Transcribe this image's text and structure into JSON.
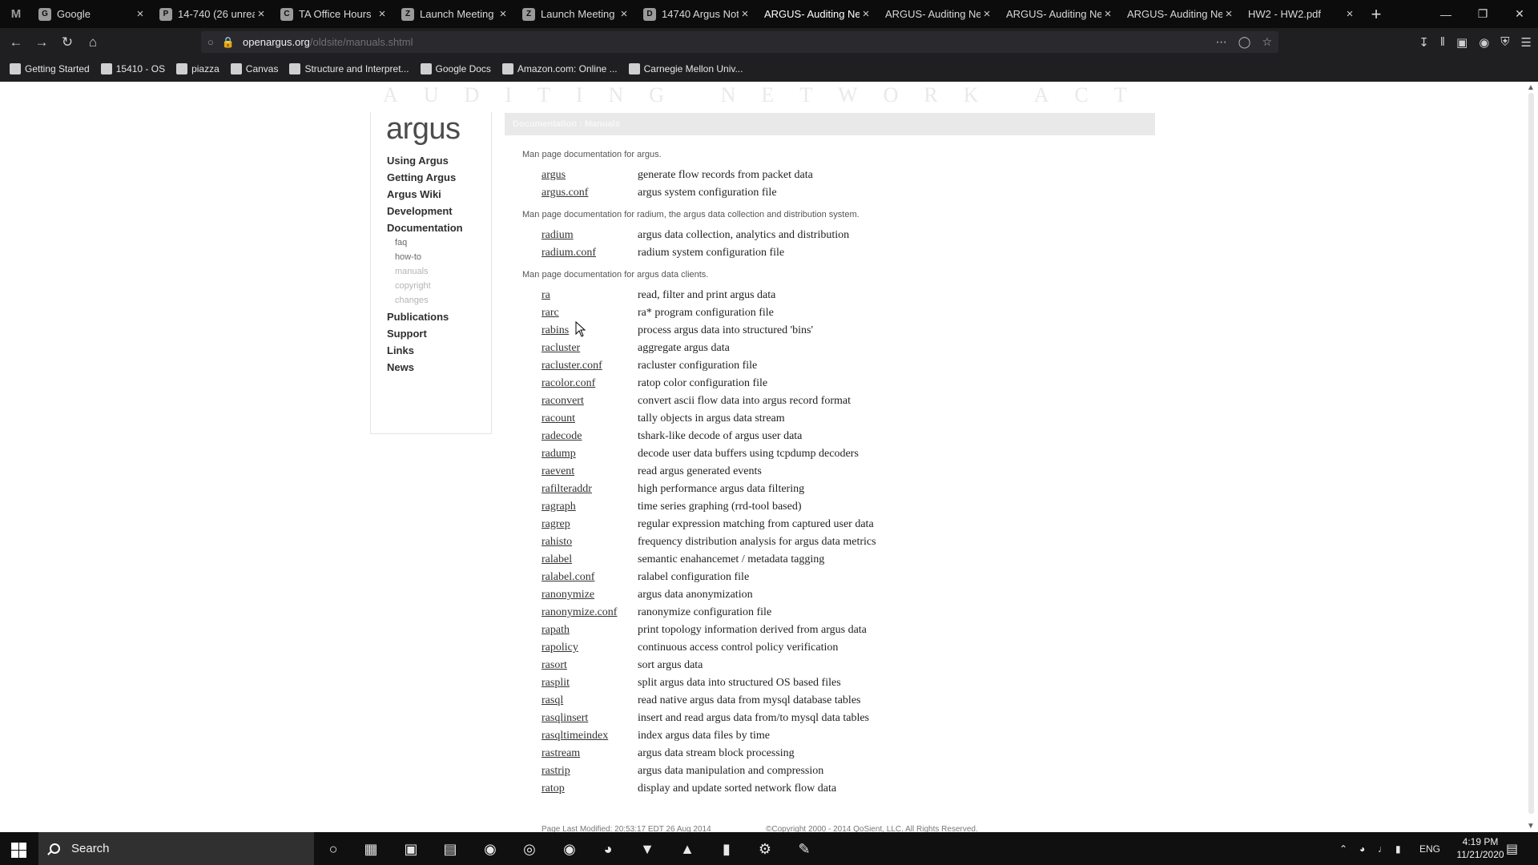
{
  "browser": {
    "tabs": [
      {
        "title": "Google",
        "favicon": "G"
      },
      {
        "title": "14-740 (26 unrea",
        "favicon": "P"
      },
      {
        "title": "TA Office Hours",
        "favicon": "C"
      },
      {
        "title": "Launch Meeting",
        "favicon": "Z"
      },
      {
        "title": "Launch Meeting",
        "favicon": "Z"
      },
      {
        "title": "14740 Argus Not",
        "favicon": "D"
      },
      {
        "title": "ARGUS- Auditing Ne",
        "favicon": ""
      },
      {
        "title": "ARGUS- Auditing Ne",
        "favicon": ""
      },
      {
        "title": "ARGUS- Auditing Ne",
        "favicon": ""
      },
      {
        "title": "ARGUS- Auditing Ne",
        "favicon": ""
      },
      {
        "title": "HW2 - HW2.pdf",
        "favicon": ""
      }
    ],
    "url_host": "openargus.org",
    "url_path": "/oldsite/manuals.shtml",
    "bookmarks": [
      {
        "label": "Getting Started",
        "icon": "gear"
      },
      {
        "label": "15410 - OS",
        "icon": "K"
      },
      {
        "label": "piazza",
        "icon": "P"
      },
      {
        "label": "Canvas",
        "icon": "C"
      },
      {
        "label": "Structure and Interpret...",
        "icon": "book"
      },
      {
        "label": "Google Docs",
        "icon": "doc"
      },
      {
        "label": "Amazon.com: Online ...",
        "icon": "a"
      },
      {
        "label": "Carnegie Mellon Univ...",
        "icon": "cmu"
      }
    ]
  },
  "site": {
    "banner": "AUDITING NETWORK ACTIVITY",
    "logo": "argus",
    "nav": [
      {
        "label": "Using Argus"
      },
      {
        "label": "Getting Argus"
      },
      {
        "label": "Argus Wiki"
      },
      {
        "label": "Development"
      },
      {
        "label": "Documentation"
      }
    ],
    "subnav": [
      {
        "label": "faq"
      },
      {
        "label": "how-to"
      },
      {
        "label": "manuals"
      },
      {
        "label": "copyright"
      },
      {
        "label": "changes"
      }
    ],
    "nav_bottom": [
      {
        "label": "Publications"
      },
      {
        "label": "Support"
      },
      {
        "label": "Links"
      },
      {
        "label": "News"
      }
    ]
  },
  "content": {
    "header": "Documentation : Manuals",
    "sections": [
      {
        "intro": "Man page documentation for argus.",
        "entries": [
          {
            "name": "argus",
            "desc": "generate flow records from packet data"
          },
          {
            "name": "argus.conf",
            "desc": "argus system configuration file"
          }
        ]
      },
      {
        "intro": "Man page documentation for radium, the argus data collection and distribution system.",
        "entries": [
          {
            "name": "radium",
            "desc": "argus data collection, analytics and distribution"
          },
          {
            "name": "radium.conf",
            "desc": "radium system configuration file"
          }
        ]
      },
      {
        "intro": "Man page documentation for argus data clients.",
        "entries": [
          {
            "name": "ra",
            "desc": "read, filter and print argus data"
          },
          {
            "name": "rarc",
            "desc": "ra* program configuration file"
          },
          {
            "name": "rabins",
            "desc": "process argus data into structured 'bins'"
          },
          {
            "name": "racluster",
            "desc": "aggregate argus data"
          },
          {
            "name": "racluster.conf",
            "desc": "racluster configuration file"
          },
          {
            "name": "racolor.conf",
            "desc": "ratop color configuration file"
          },
          {
            "name": "raconvert",
            "desc": "convert ascii flow data into argus record format"
          },
          {
            "name": "racount",
            "desc": "tally objects in argus data stream"
          },
          {
            "name": "radecode",
            "desc": "tshark-like decode of argus user data"
          },
          {
            "name": "radump",
            "desc": "decode user data buffers using tcpdump decoders"
          },
          {
            "name": "raevent",
            "desc": "read argus generated events"
          },
          {
            "name": "rafilteraddr",
            "desc": "high performance argus data filtering"
          },
          {
            "name": "ragraph",
            "desc": "time series graphing (rrd-tool based)"
          },
          {
            "name": "ragrep",
            "desc": "regular expression matching from captured user data"
          },
          {
            "name": "rahisto",
            "desc": "frequency distribution analysis for argus data metrics"
          },
          {
            "name": "ralabel",
            "desc": "semantic enahancemet / metadata tagging"
          },
          {
            "name": "ralabel.conf",
            "desc": "ralabel configuration file"
          },
          {
            "name": "ranonymize",
            "desc": "argus data anonymization"
          },
          {
            "name": "ranonymize.conf",
            "desc": "ranonymize configuration file"
          },
          {
            "name": "rapath",
            "desc": "print topology information derived from argus data"
          },
          {
            "name": "rapolicy",
            "desc": "continuous access control policy verification"
          },
          {
            "name": "rasort",
            "desc": "sort argus data"
          },
          {
            "name": "rasplit",
            "desc": "split argus data into structured OS based files"
          },
          {
            "name": "rasql",
            "desc": "read native argus data from mysql database tables"
          },
          {
            "name": "rasqlinsert",
            "desc": "insert and read argus data from/to mysql data tables"
          },
          {
            "name": "rasqltimeindex",
            "desc": "index argus data files by time"
          },
          {
            "name": "rastream",
            "desc": "argus data stream block processing"
          },
          {
            "name": "rastrip",
            "desc": "argus data manipulation and compression"
          },
          {
            "name": "ratop",
            "desc": "display and update sorted network flow data"
          }
        ]
      }
    ],
    "footer_left": "Page Last Modified: 20:53:17 EDT 26 Aug 2014",
    "footer_right": "©Copyright 2000 - 2014 QoSient, LLC. All Rights Reserved."
  },
  "taskbar": {
    "search_placeholder": "Search",
    "language": "ENG",
    "time": "4:19 PM",
    "date": "11/21/2020"
  }
}
